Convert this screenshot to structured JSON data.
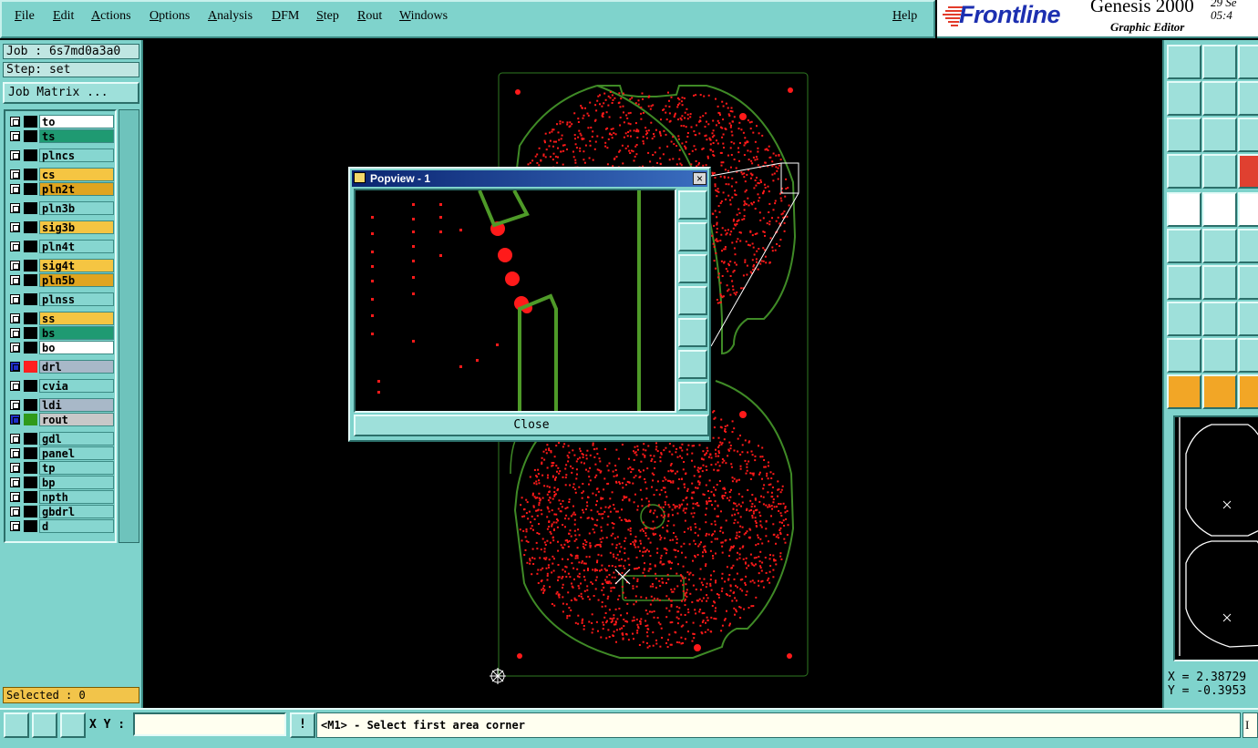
{
  "menubar": {
    "items": [
      "File",
      "Edit",
      "Actions",
      "Options",
      "Analysis",
      "DFM",
      "Step",
      "Rout",
      "Windows"
    ],
    "help": "Help"
  },
  "brand": {
    "name": "Frontline",
    "product": "Genesis 2000",
    "subtitle": "Graphic Editor",
    "date_line1": "29 Se",
    "date_line2": "05:4"
  },
  "job": {
    "job_label": "Job : 6s7md0a3a0",
    "step_label": "Step: set",
    "matrix_button": "Job Matrix ..."
  },
  "layers": [
    {
      "name": "to",
      "color": "#ffffff"
    },
    {
      "name": "ts",
      "color": "#1f9a72"
    },
    {
      "name": "plncs",
      "color": "#86d6d0"
    },
    {
      "name": "cs",
      "color": "#f5c542"
    },
    {
      "name": "pln2t",
      "color": "#e0a520"
    },
    {
      "name": "pln3b",
      "color": "#86d6d0"
    },
    {
      "name": "sig3b",
      "color": "#f5c542"
    },
    {
      "name": "pln4t",
      "color": "#86d6d0"
    },
    {
      "name": "sig4t",
      "color": "#f5c542"
    },
    {
      "name": "pln5b",
      "color": "#e0a520"
    },
    {
      "name": "plnss",
      "color": "#86d6d0"
    },
    {
      "name": "ss",
      "color": "#f5c542"
    },
    {
      "name": "bs",
      "color": "#1f9a72"
    },
    {
      "name": "bo",
      "color": "#ffffff"
    },
    {
      "name": "drl",
      "color": "#a8b8c8",
      "active": true,
      "swatch": "#ff2020"
    },
    {
      "name": "cvia",
      "color": "#86d6d0"
    },
    {
      "name": "ldi",
      "color": "#a8b8c8"
    },
    {
      "name": "rout",
      "color": "#c8c8c8",
      "active": true,
      "swatch": "#2f9a1a"
    },
    {
      "name": "gdl",
      "color": "#86d6d0"
    },
    {
      "name": "panel",
      "color": "#86d6d0"
    },
    {
      "name": "tp",
      "color": "#86d6d0"
    },
    {
      "name": "bp",
      "color": "#86d6d0"
    },
    {
      "name": "npth",
      "color": "#86d6d0"
    },
    {
      "name": "gbdrl",
      "color": "#86d6d0"
    },
    {
      "name": "d",
      "color": "#86d6d0"
    }
  ],
  "selected": "Selected : 0",
  "popview": {
    "title": "Popview - 1",
    "close_label": "Close",
    "close_x": "×"
  },
  "coords": {
    "x": "X = 2.38729",
    "y": "Y = -0.3953"
  },
  "bottom": {
    "xy_label": "X Y :",
    "xy_value": "",
    "warn_icon": "!",
    "status": "<M1> - Select first area corner",
    "status_right": "I"
  },
  "colors": {
    "panel": "#7fd3cc",
    "pad_red": "#ff1a1a",
    "rout_green": "#3f8a26",
    "outline": "#2f7a22"
  }
}
